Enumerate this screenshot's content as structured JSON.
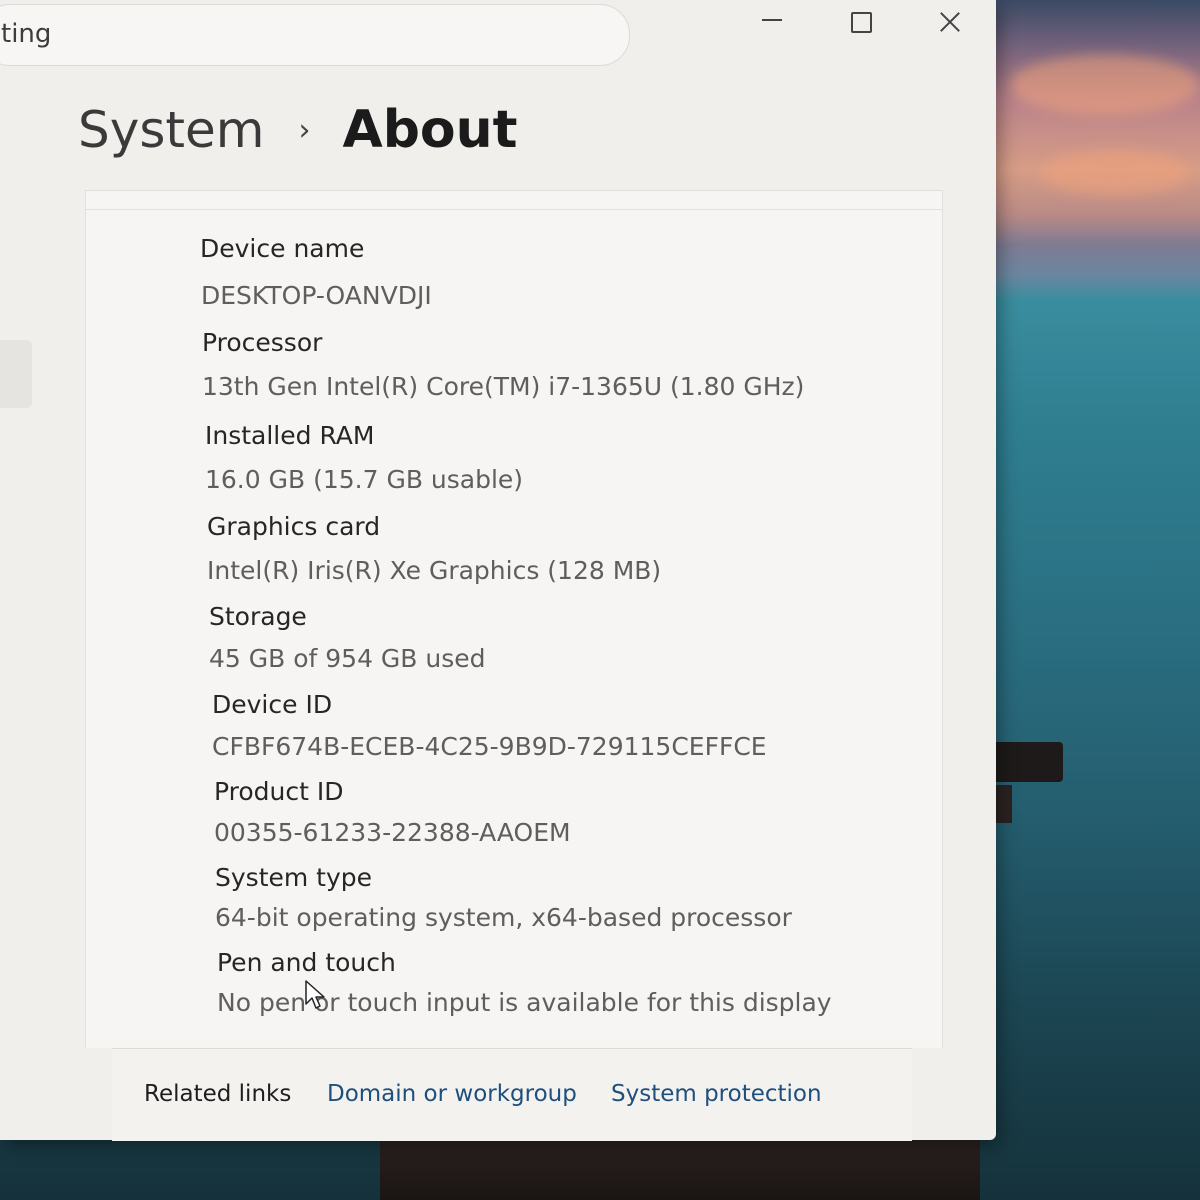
{
  "search": {
    "text": "ting"
  },
  "breadcrumb": {
    "parent": "System",
    "separator": "›",
    "current": "About"
  },
  "specs": [
    {
      "label": "Device name",
      "value": "DESKTOP-OANVDJI"
    },
    {
      "label": "Processor",
      "value": "13th Gen Intel(R) Core(TM) i7-1365U (1.80 GHz)"
    },
    {
      "label": "Installed RAM",
      "value": "16.0 GB (15.7 GB usable)"
    },
    {
      "label": "Graphics card",
      "value": "Intel(R) Iris(R) Xe Graphics (128 MB)"
    },
    {
      "label": "Storage",
      "value": "45 GB of 954 GB used"
    },
    {
      "label": "Device ID",
      "value": "CFBF674B-ECEB-4C25-9B9D-729115CEFFCE"
    },
    {
      "label": "Product ID",
      "value": "00355-61233-22388-AAOEM"
    },
    {
      "label": "System type",
      "value": "64-bit operating system, x64-based processor"
    },
    {
      "label": "Pen and touch",
      "value": "No pen or touch input is available for this display"
    }
  ],
  "related_links": {
    "label": "Related links",
    "links": [
      "Domain or workgroup",
      "System protection"
    ]
  },
  "icons": {
    "minimize": "minimize-icon",
    "maximize": "maximize-icon",
    "close": "close-icon",
    "cursor": "mouse-cursor-icon"
  }
}
